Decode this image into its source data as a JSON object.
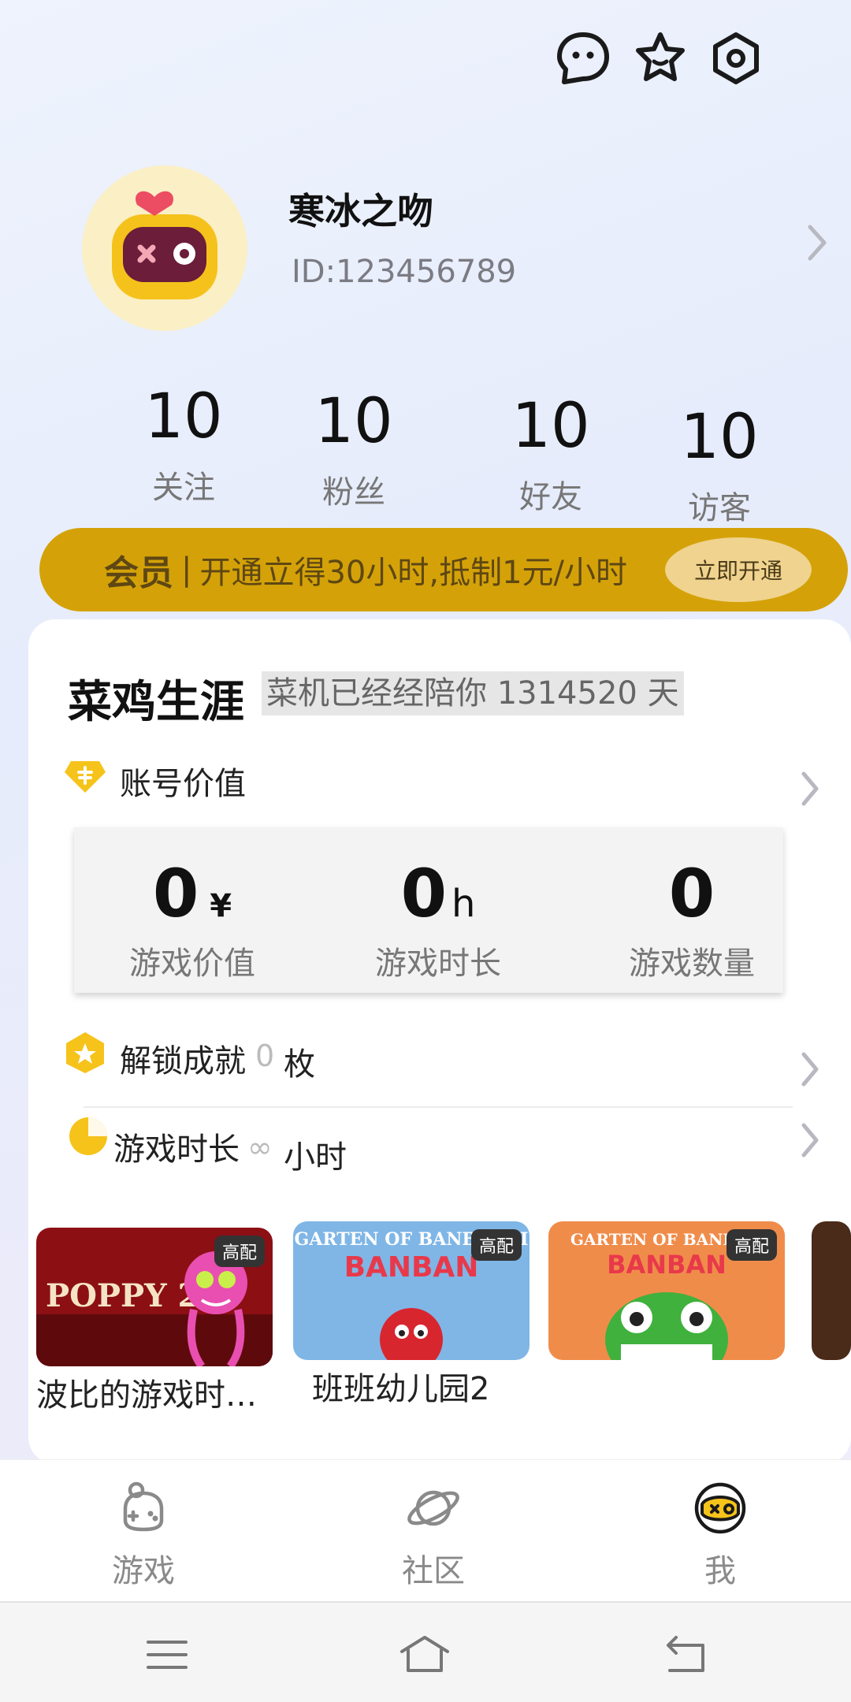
{
  "header": {
    "icons": [
      "chat-bubble-icon",
      "star-icon",
      "settings-icon"
    ]
  },
  "profile": {
    "name": "寒冰之吻",
    "id": "ID:123456789"
  },
  "stats": [
    {
      "value": "10",
      "label": "关注"
    },
    {
      "value": "10",
      "label": "粉丝"
    },
    {
      "value": "10",
      "label": "好友"
    },
    {
      "value": "10",
      "label": "访客"
    }
  ],
  "vip": {
    "label": "会员",
    "separator": "|",
    "text": "开通立得30小时,抵制1元/小时",
    "button": "立即开通"
  },
  "career": {
    "title": "菜鸡生涯",
    "subtitle": "菜机已经经陪你 1314520 天",
    "account_value": {
      "label": "账号价值",
      "items": [
        {
          "value": "0",
          "unit": "¥",
          "label": "游戏价值"
        },
        {
          "value": "0",
          "unit": "h",
          "label": "游戏时长"
        },
        {
          "value": "0",
          "unit": "",
          "label": "游戏数量"
        }
      ]
    },
    "achievements": {
      "label": "解锁成就",
      "value": "0",
      "unit": "枚"
    },
    "playtime": {
      "label": "游戏时长",
      "value": "∞",
      "unit": "小时"
    }
  },
  "games": [
    {
      "title": "波比的游戏时…",
      "badge": "高配",
      "art_text": "POPPY 2"
    },
    {
      "title": "班班幼儿园2",
      "badge": "高配",
      "art_text": "GARTEN OF BANBAN II"
    },
    {
      "title": "",
      "badge": "高配",
      "art_text": "GARTEN OF BANBAN"
    }
  ],
  "bottom_nav": [
    {
      "label": "游戏",
      "icon": "game-icon"
    },
    {
      "label": "社区",
      "icon": "planet-icon"
    },
    {
      "label": "我",
      "icon": "me-icon"
    }
  ],
  "colors": {
    "vip_bg": "#d4a208",
    "vip_btn": "#f0d38e",
    "accent_yellow": "#f6c31a"
  }
}
